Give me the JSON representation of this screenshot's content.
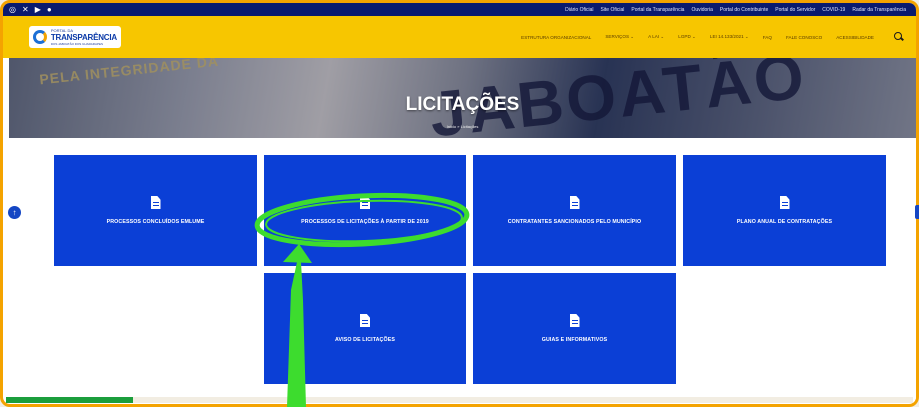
{
  "topbar": {
    "social_icons": [
      "instagram-icon",
      "x-icon",
      "youtube-icon",
      "facebook-icon"
    ],
    "social_glyphs": [
      "◎",
      "✕",
      "▶",
      "●"
    ],
    "links": [
      "Diário Oficial",
      "Site Oficial",
      "Portal da Transparência",
      "Ouvidoria",
      "Portal do Contribuinte",
      "Portal do Servidor",
      "COVID-19",
      "Radar da Transparência"
    ]
  },
  "header": {
    "logo": {
      "small": "PORTAL DA",
      "big": "TRANSPARÊNCIA",
      "sub": "DOS JABOATÃO DOS GUARARAPES"
    },
    "menu": [
      "ESTRUTURA ORGANIZACIONAL",
      "SERVIÇOS ⌄",
      "A LAI ⌄",
      "LGPD ⌄",
      "LEI 14.133/2021 ⌄",
      "FAQ",
      "FALE CONOSCO",
      "ACESSIBILIDADE"
    ]
  },
  "hero": {
    "banner_text_1": "PELA INTEGRIDADE DA",
    "banner_text_2": "JABOATÃO",
    "title": "LICITAÇÕES",
    "breadcrumb": "Início » Licitações"
  },
  "tiles": [
    {
      "label": "PROCESSOS CONCLUÍDOS EMLUME"
    },
    {
      "label": "PROCESSOS DE LICITAÇÕES À PARTIR DE 2019"
    },
    {
      "label": "CONTRATANTES SANCIONADOS PELO MUNICÍPIO"
    },
    {
      "label": "PLANO ANUAL DE CONTRATAÇÕES"
    },
    {
      "label": "AVISO DE LICITAÇÕES"
    },
    {
      "label": "GUIAS E INFORMATIVOS"
    }
  ],
  "side_nav": {
    "left_glyph": "↑"
  },
  "colors": {
    "accent_yellow": "#f7c600",
    "topbar_navy": "#0a1a6e",
    "tile_blue": "#0b3fd6",
    "frame_orange": "#f4a300",
    "annotation_green": "#3ddc2e"
  }
}
